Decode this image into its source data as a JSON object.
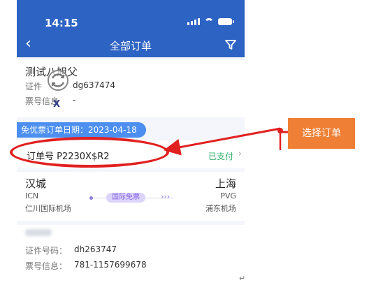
{
  "status": {
    "time": "14:15"
  },
  "nav": {
    "title": "全部订单"
  },
  "passenger1": {
    "name": "测试八旭父",
    "id_label": "证件",
    "id_value": "dg637474",
    "ticket_label": "票号信息",
    "ticket_value": "-"
  },
  "order": {
    "date_tag": "免优票订单日期：2023-04-18",
    "number": "订单号 P2230X$R2",
    "status": "已支付"
  },
  "flight": {
    "from_city": "汉城",
    "from_code": "ICN",
    "from_airport": "仁川国际机场",
    "to_city": "上海",
    "to_code": "PVG",
    "to_airport": "浦东机场",
    "badge": "国际免票"
  },
  "passenger2": {
    "id_label": "证件号码：",
    "id_value": "dh263747",
    "ticket_label": "票号信息：",
    "ticket_value": "781-1157699678"
  },
  "annotation": {
    "callout": "选择订单",
    "stray_x": "X"
  },
  "colors": {
    "brand_blue": "#2d63c3",
    "tag_blue": "#4c8ff0",
    "paid_green": "#35b06d",
    "badge_purple": "#8966e8",
    "annotation_red": "#e12020",
    "callout_orange": "#ef7f34"
  }
}
